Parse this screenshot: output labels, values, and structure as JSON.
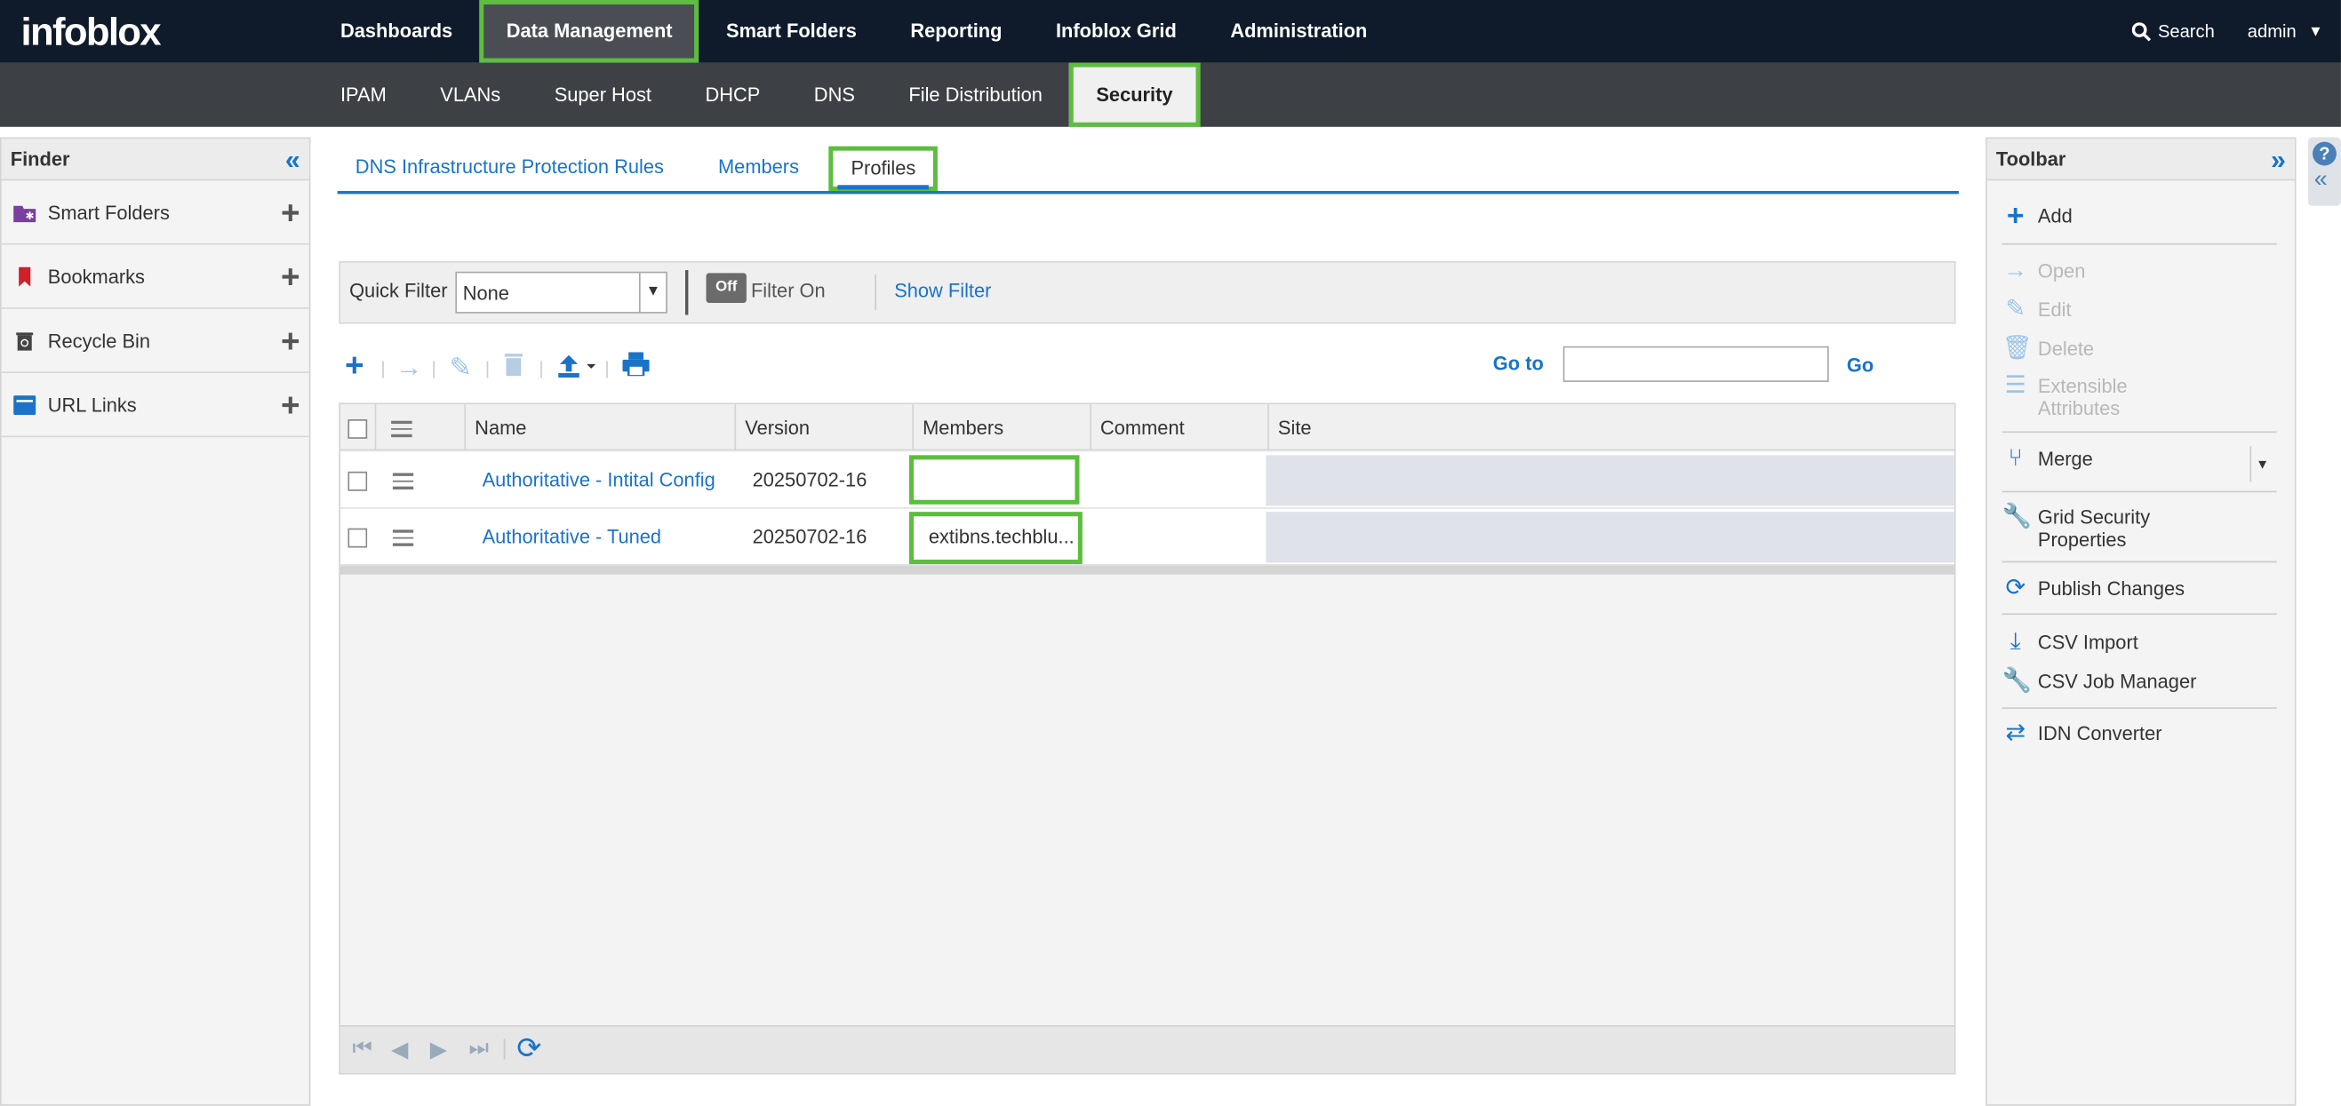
{
  "app": {
    "logo": "infoblox"
  },
  "topnav": {
    "items": [
      "Dashboards",
      "Data Management",
      "Smart Folders",
      "Reporting",
      "Infoblox Grid",
      "Administration"
    ],
    "active": "Data Management",
    "search_label": "Search",
    "user": "admin"
  },
  "subnav": {
    "items": [
      "IPAM",
      "VLANs",
      "Super Host",
      "DHCP",
      "DNS",
      "File Distribution",
      "Security"
    ],
    "active": "Security"
  },
  "finder": {
    "title": "Finder",
    "items": [
      {
        "label": "Smart Folders",
        "icon": "smart-folder-icon",
        "color": "#7b3fa0"
      },
      {
        "label": "Bookmarks",
        "icon": "bookmark-icon",
        "color": "#d0202a"
      },
      {
        "label": "Recycle Bin",
        "icon": "recycle-bin-icon",
        "color": "#444444"
      },
      {
        "label": "URL Links",
        "icon": "url-links-icon",
        "color": "#1a73c8"
      }
    ]
  },
  "tabs": {
    "items": [
      "DNS Infrastructure Protection Rules",
      "Members",
      "Profiles"
    ],
    "active": "Profiles"
  },
  "quick_filter": {
    "label": "Quick Filter",
    "value": "None",
    "toggle": "Off",
    "filter_on": "Filter On",
    "show_filter": "Show Filter"
  },
  "goto": {
    "label": "Go to",
    "button": "Go",
    "value": ""
  },
  "grid": {
    "columns": [
      "Name",
      "Version",
      "Members",
      "Comment",
      "Site"
    ],
    "rows": [
      {
        "name": "Authoritative - Intital Config",
        "version": "20250702-16",
        "members": "",
        "comment": "",
        "site": ""
      },
      {
        "name": "Authoritative - Tuned",
        "version": "20250702-16",
        "members": "extibns.techblu...",
        "comment": "",
        "site": ""
      }
    ]
  },
  "toolbar": {
    "title": "Toolbar",
    "add": "Add",
    "open": "Open",
    "edit": "Edit",
    "delete": "Delete",
    "ext_attr": "Extensible Attributes",
    "merge": "Merge",
    "grid_security": "Grid Security Properties",
    "publish": "Publish Changes",
    "csv_import": "CSV Import",
    "csv_job": "CSV Job Manager",
    "idn": "IDN Converter"
  },
  "colors": {
    "accent": "#1a73c8",
    "highlight": "#5cbd3e",
    "topbar": "#0f1b2b",
    "subbar": "#3d4045"
  }
}
